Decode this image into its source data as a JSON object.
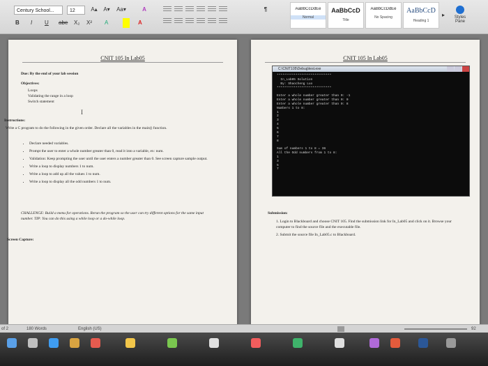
{
  "ribbon": {
    "font_name": "Century School...",
    "font_size": "12",
    "grow": "A▴",
    "shrink": "A▾",
    "case": "Aa▾",
    "bold": "B",
    "italic": "I",
    "underline": "U",
    "strike": "abe",
    "sub": "X₂",
    "sup": "X²",
    "pilcrow": "¶",
    "styles": [
      {
        "sample": "AaBbCcDdEe",
        "name": "Normal"
      },
      {
        "sample": "AaBbCcD",
        "name": "Title"
      },
      {
        "sample": "AaBbCcDdEe",
        "name": "No Spacing"
      },
      {
        "sample": "AaBbCcD",
        "name": "Heading 1"
      }
    ],
    "styles_pane": "Styles Pane"
  },
  "left_page": {
    "title": "CNIT 105 In Lab05",
    "due": "Due: By the end of your lab session",
    "objectives_heading": "Objectives:",
    "objectives": [
      "Loops",
      "Validating the range in a loop",
      "Switch statement"
    ],
    "instructions_heading": "Instructions:",
    "intro": "Write a C program to do the following in the given order. Declare all the variables in the main() function.",
    "bullets": [
      "Declare needed variables.",
      "Prompt the user to enter a whole number greater than 0, read it into a variable, ex: num.",
      "Validation: Keep prompting the user until the user enters a number greater than 0. See screen capture sample output.",
      "Write a loop to display numbers 1 to num.",
      "Write a loop to add up all the values 1 to num.",
      "Write a loop to display all the odd numbers 1 to num."
    ],
    "challenge": "CHALLENGE: Build a menu for operations. Rerun the program so the user can try different options for the same input number. TIP: You can do this using a while loop or a do-while loop.",
    "screen_capture": "Screen Capture:"
  },
  "right_page": {
    "title": "CNIT 105 In Lab05",
    "console_title": "C:\\CNIT105\\Debug\\test.exe",
    "console_lines": [
      "*****************************",
      "  In_Lab05 Solution",
      "  By: Shaocheng Luo",
      "*****************************",
      "",
      "Enter a whole number greater than 0: -1",
      "Enter a whole number greater than 0: 0",
      "Enter a whole number greater than 0: 8",
      "Numbers 1 to 8:",
      "1",
      "2",
      "3",
      "4",
      "5",
      "6",
      "7",
      "8",
      "",
      "Sum of numbers 1 to 8 = 36",
      "All the Odd numbers from 1 to 8:",
      "1",
      "3",
      "5",
      "7"
    ],
    "submission_heading": "Submission:",
    "submission": [
      "1.  Login to Blackboard and choose CNIT 105. Find the submission link for In_Lab05 and click on it. Browse your computer to find the source file and the executable file.",
      "2.  Submit the source file In_Lab05.c to Blackboard."
    ]
  },
  "status": {
    "page": "of 2",
    "words": "180 Words",
    "language": "English (US)",
    "zoom": "92"
  }
}
